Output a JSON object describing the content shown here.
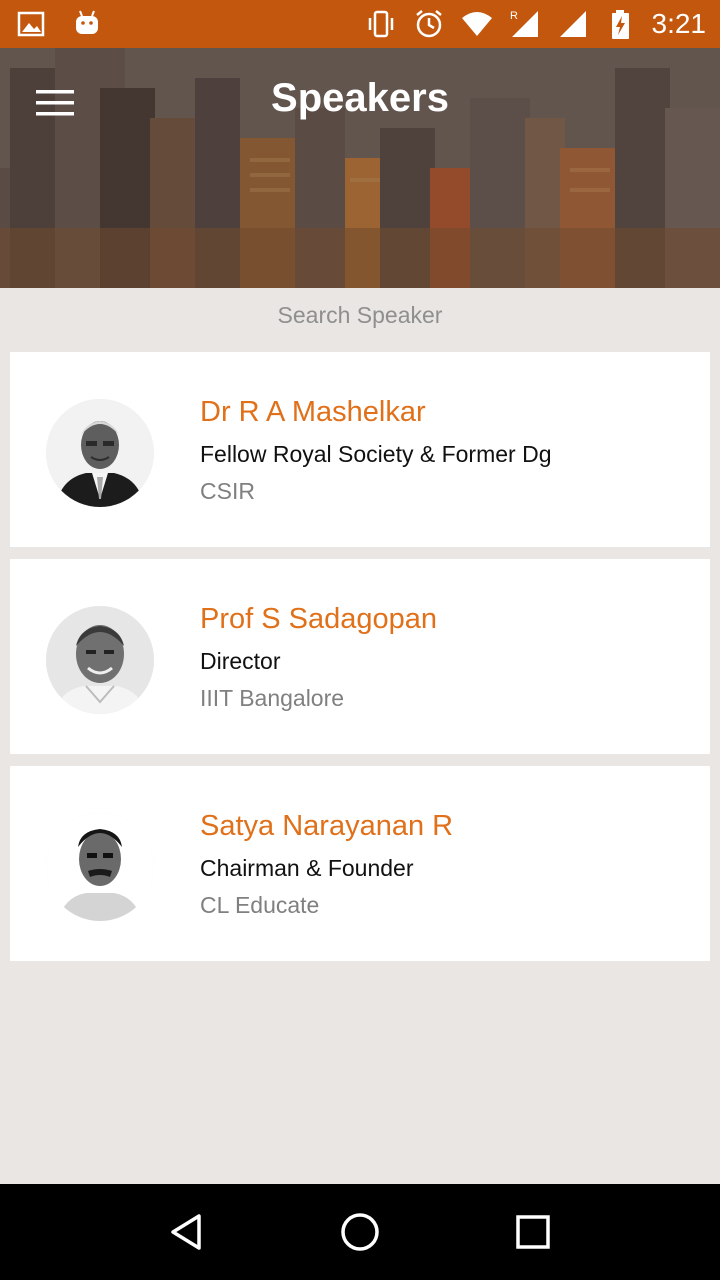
{
  "status_bar": {
    "time": "3:21",
    "left_icons": [
      "image-icon",
      "android-icon"
    ],
    "right_icons": [
      "vibrate-icon",
      "alarm-icon",
      "wifi-icon",
      "cell-signal-roaming-icon",
      "cell-signal-icon",
      "battery-charging-icon"
    ],
    "background": "#c4570e"
  },
  "header": {
    "title": "Speakers",
    "menu_icon": "hamburger-menu-icon"
  },
  "search": {
    "placeholder": "Search Speaker",
    "value": ""
  },
  "speakers": [
    {
      "name": "Dr R A Mashelkar",
      "role": "Fellow Royal Society & Former Dg",
      "organization": "CSIR"
    },
    {
      "name": "Prof S Sadagopan",
      "role": "Director",
      "organization": "IIIT Bangalore"
    },
    {
      "name": "Satya Narayanan R",
      "role": "Chairman & Founder",
      "organization": "CL Educate"
    }
  ],
  "colors": {
    "accent": "#e0711a",
    "status_bar": "#c4570e",
    "background": "#e9e6e4"
  },
  "nav_bar": {
    "buttons": [
      "back-icon",
      "home-icon",
      "recents-icon"
    ]
  }
}
